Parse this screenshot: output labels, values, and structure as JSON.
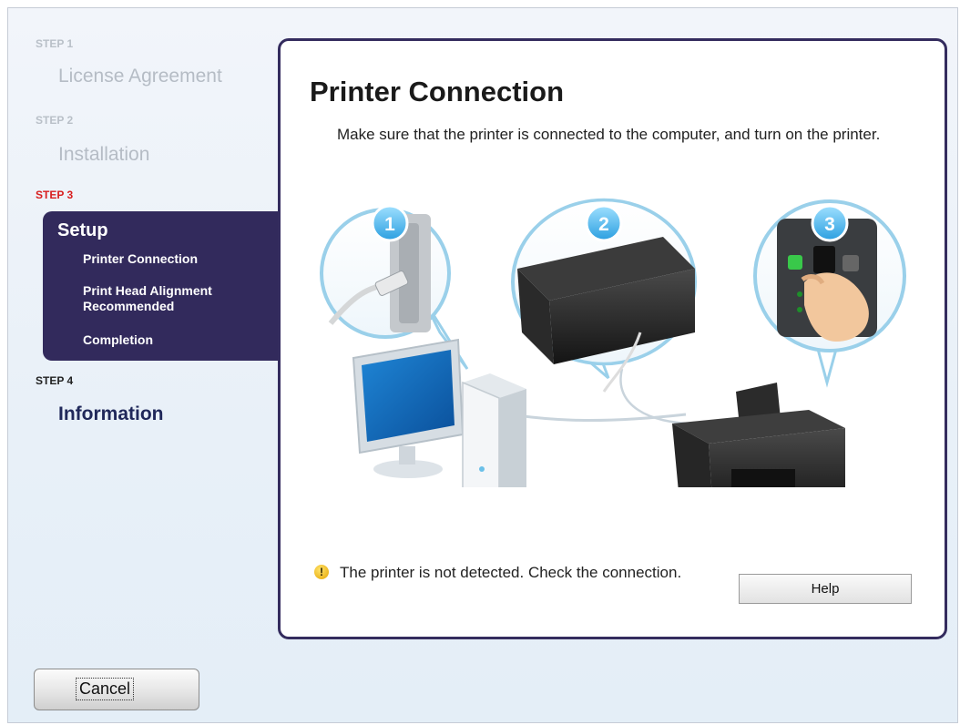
{
  "steps": {
    "step1": {
      "label": "STEP 1",
      "title": "License Agreement"
    },
    "step2": {
      "label": "STEP 2",
      "title": "Installation"
    },
    "step3": {
      "label": "STEP 3",
      "title": "Setup",
      "items": [
        "Printer Connection",
        "Print Head Alignment Recommended",
        "Completion"
      ]
    },
    "step4": {
      "label": "STEP 4",
      "title": "Information"
    }
  },
  "main": {
    "title": "Printer Connection",
    "description": "Make sure that the printer is connected to the computer, and turn on the printer.",
    "illustration": {
      "badges": [
        "1",
        "2",
        "3"
      ]
    },
    "warning": {
      "icon": "warning-icon",
      "text": "The printer is not detected. Check the connection."
    },
    "help_label": "Help"
  },
  "footer": {
    "cancel_label": "Cancel"
  },
  "colors": {
    "nav_active_bg": "#322a5c",
    "step_active": "#d81e1e",
    "panel_border": "#342c5e"
  }
}
